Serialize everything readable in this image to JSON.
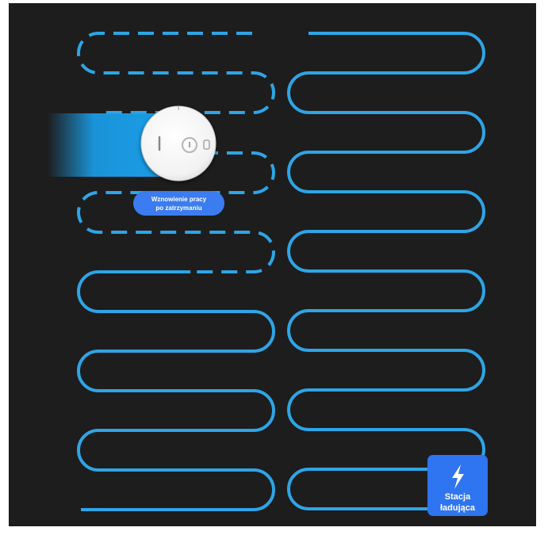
{
  "colors": {
    "background": "#1d1d1d",
    "path": "#2ea5e6",
    "trail": "#1aa0ec",
    "badge": "#3b7cf0",
    "station": "#2f74f0",
    "robot_body": "#ffffff"
  },
  "robot": {
    "icon": "robot-vacuum-icon",
    "tooltip_line1": "Wznowienie pracy",
    "tooltip_line2": "po zatrzymaniu"
  },
  "station": {
    "icon": "lightning-bolt-icon",
    "label_line1": "Stacja",
    "label_line2": "ładująca"
  }
}
